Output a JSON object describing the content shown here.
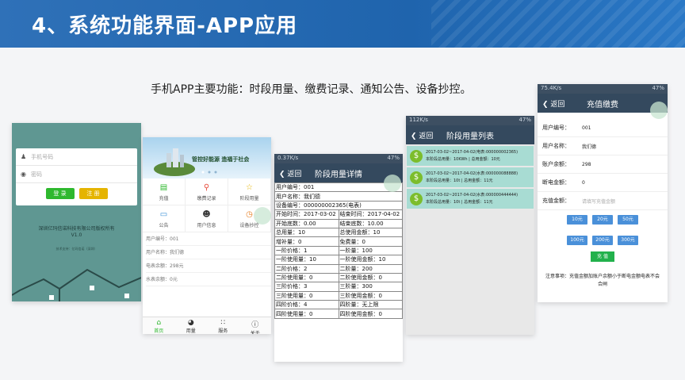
{
  "header": {
    "title": "4、系统功能界面-APP应用"
  },
  "subtitle": "手机APP主要功能：时段用量、缴费记录、通知公告、设备抄控。",
  "login": {
    "phone_placeholder": "手机号码",
    "password_placeholder": "密码",
    "login_label": "登 录",
    "register_label": "注 册",
    "copyright": "深圳亿玛信诺科技有限公司版权所有",
    "version": "V1.0",
    "footer": "技术支持：亿玛信诺（深圳）"
  },
  "home": {
    "banner": "管控好能源 造福于社会",
    "grid": [
      {
        "label": "充值",
        "icon": "cart-icon"
      },
      {
        "label": "缴费记录",
        "icon": "search-icon"
      },
      {
        "label": "阶段用量",
        "icon": "star-icon"
      },
      {
        "label": "公告",
        "icon": "message-icon"
      },
      {
        "label": "用户信息",
        "icon": "user-icon"
      },
      {
        "label": "设备抄控",
        "icon": "clock-icon"
      }
    ],
    "info": [
      "用户编号：001",
      "用户名称：我们德",
      "电表余额：298元",
      "水表余额：0元"
    ],
    "tabs": [
      {
        "label": "首页",
        "icon": "home-icon"
      },
      {
        "label": "用量",
        "icon": "chart-icon"
      },
      {
        "label": "服务",
        "icon": "grid-icon"
      },
      {
        "label": "关于",
        "icon": "info-icon"
      }
    ]
  },
  "detail": {
    "status": "0.37K/s",
    "battery": "47%",
    "back_label": "返回",
    "title": "阶段用量详情",
    "rows": [
      [
        "用户编号：001"
      ],
      [
        "用户名称：我们德"
      ],
      [
        "设备编号：000000002365(电表)"
      ],
      [
        "开始时间：2017-03-02",
        "结束时间：2017-04-02"
      ],
      [
        "开始底数：0.00",
        "结束底数：10.00"
      ],
      [
        "总用量：10",
        "总使用金额：10"
      ],
      [
        "增补量：0",
        "免费量：0"
      ],
      [
        "一阶价格：1",
        "一阶量：100"
      ],
      [
        "一阶使用量：10",
        "一阶使用金额：10"
      ],
      [
        "二阶价格：2",
        "二阶量：200"
      ],
      [
        "二阶使用量：0",
        "二阶使用金额：0"
      ],
      [
        "三阶价格：3",
        "三阶量：300"
      ],
      [
        "三阶使用量：0",
        "三阶使用金额：0"
      ],
      [
        "四阶价格：4",
        "四阶量：无上限"
      ],
      [
        "四阶使用量：0",
        "四阶使用金额：0"
      ]
    ]
  },
  "list": {
    "status": "112K/s",
    "battery": "47%",
    "back_label": "返回",
    "title": "阶段用量列表",
    "items": [
      {
        "line1": "2017-03-02~2017-04-02(电表:000000002365)",
        "line2": "本阶段总用量：10KWh | 总用金额：10元"
      },
      {
        "line1": "2017-03-02~2017-04-02(水表:000000088888)",
        "line2": "本阶段总用量：10t | 总用金额：11元"
      },
      {
        "line1": "2017-03-02~2017-04-02(水表:000000444444)",
        "line2": "本阶段总用量：10t | 总用金额：11元"
      }
    ]
  },
  "recharge": {
    "status": "75.4K/s",
    "battery": "47%",
    "back_label": "返回",
    "title": "充值缴费",
    "user_no_label": "用户编号：",
    "user_no": "001",
    "user_name_label": "用户名称：",
    "user_name": "我们德",
    "balance_label": "账户余额：",
    "balance": "298",
    "cut_label": "断电金额：",
    "cut": "0",
    "amount_label": "充值金额：",
    "amount_placeholder": "请填写充值金额",
    "amounts": [
      "10元",
      "20元",
      "50元",
      "100元",
      "200元",
      "300元"
    ],
    "pay_label": "充 值",
    "note": "注意事项：充值金额加账户余额小于断电金额电表不会合闸"
  }
}
